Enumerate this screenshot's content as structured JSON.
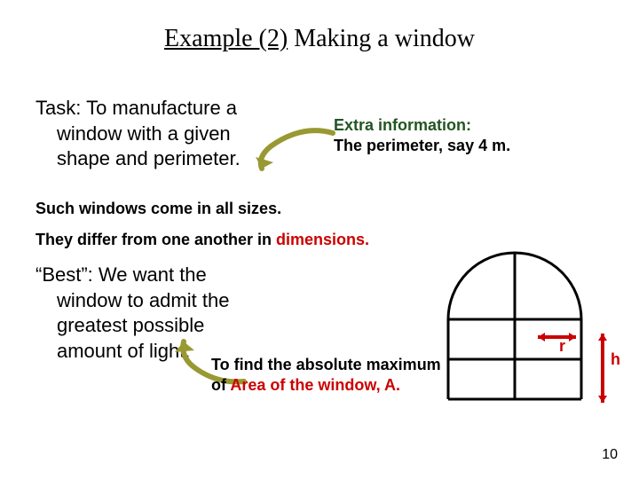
{
  "title": {
    "prefix": "Example (2)",
    "rest": " Making a window"
  },
  "task": {
    "line1": "Task: To manufacture a",
    "line2": "window with a given",
    "line3": "shape and perimeter."
  },
  "extra": {
    "line1": "Extra information:",
    "line2": "The perimeter, say 4 m."
  },
  "all_sizes": "Such windows come in all sizes.",
  "differ": {
    "prefix": "They differ from one another in ",
    "red": "dimensions."
  },
  "best": {
    "line1": "“Best”: We want the",
    "line2": "window to admit the",
    "line3": "greatest possible",
    "line4": "amount of light."
  },
  "find": {
    "p1": "To find the absolute maximum of ",
    "red": "Area of the window,  A."
  },
  "labels": {
    "r": "r",
    "h": "h"
  },
  "page": "10"
}
